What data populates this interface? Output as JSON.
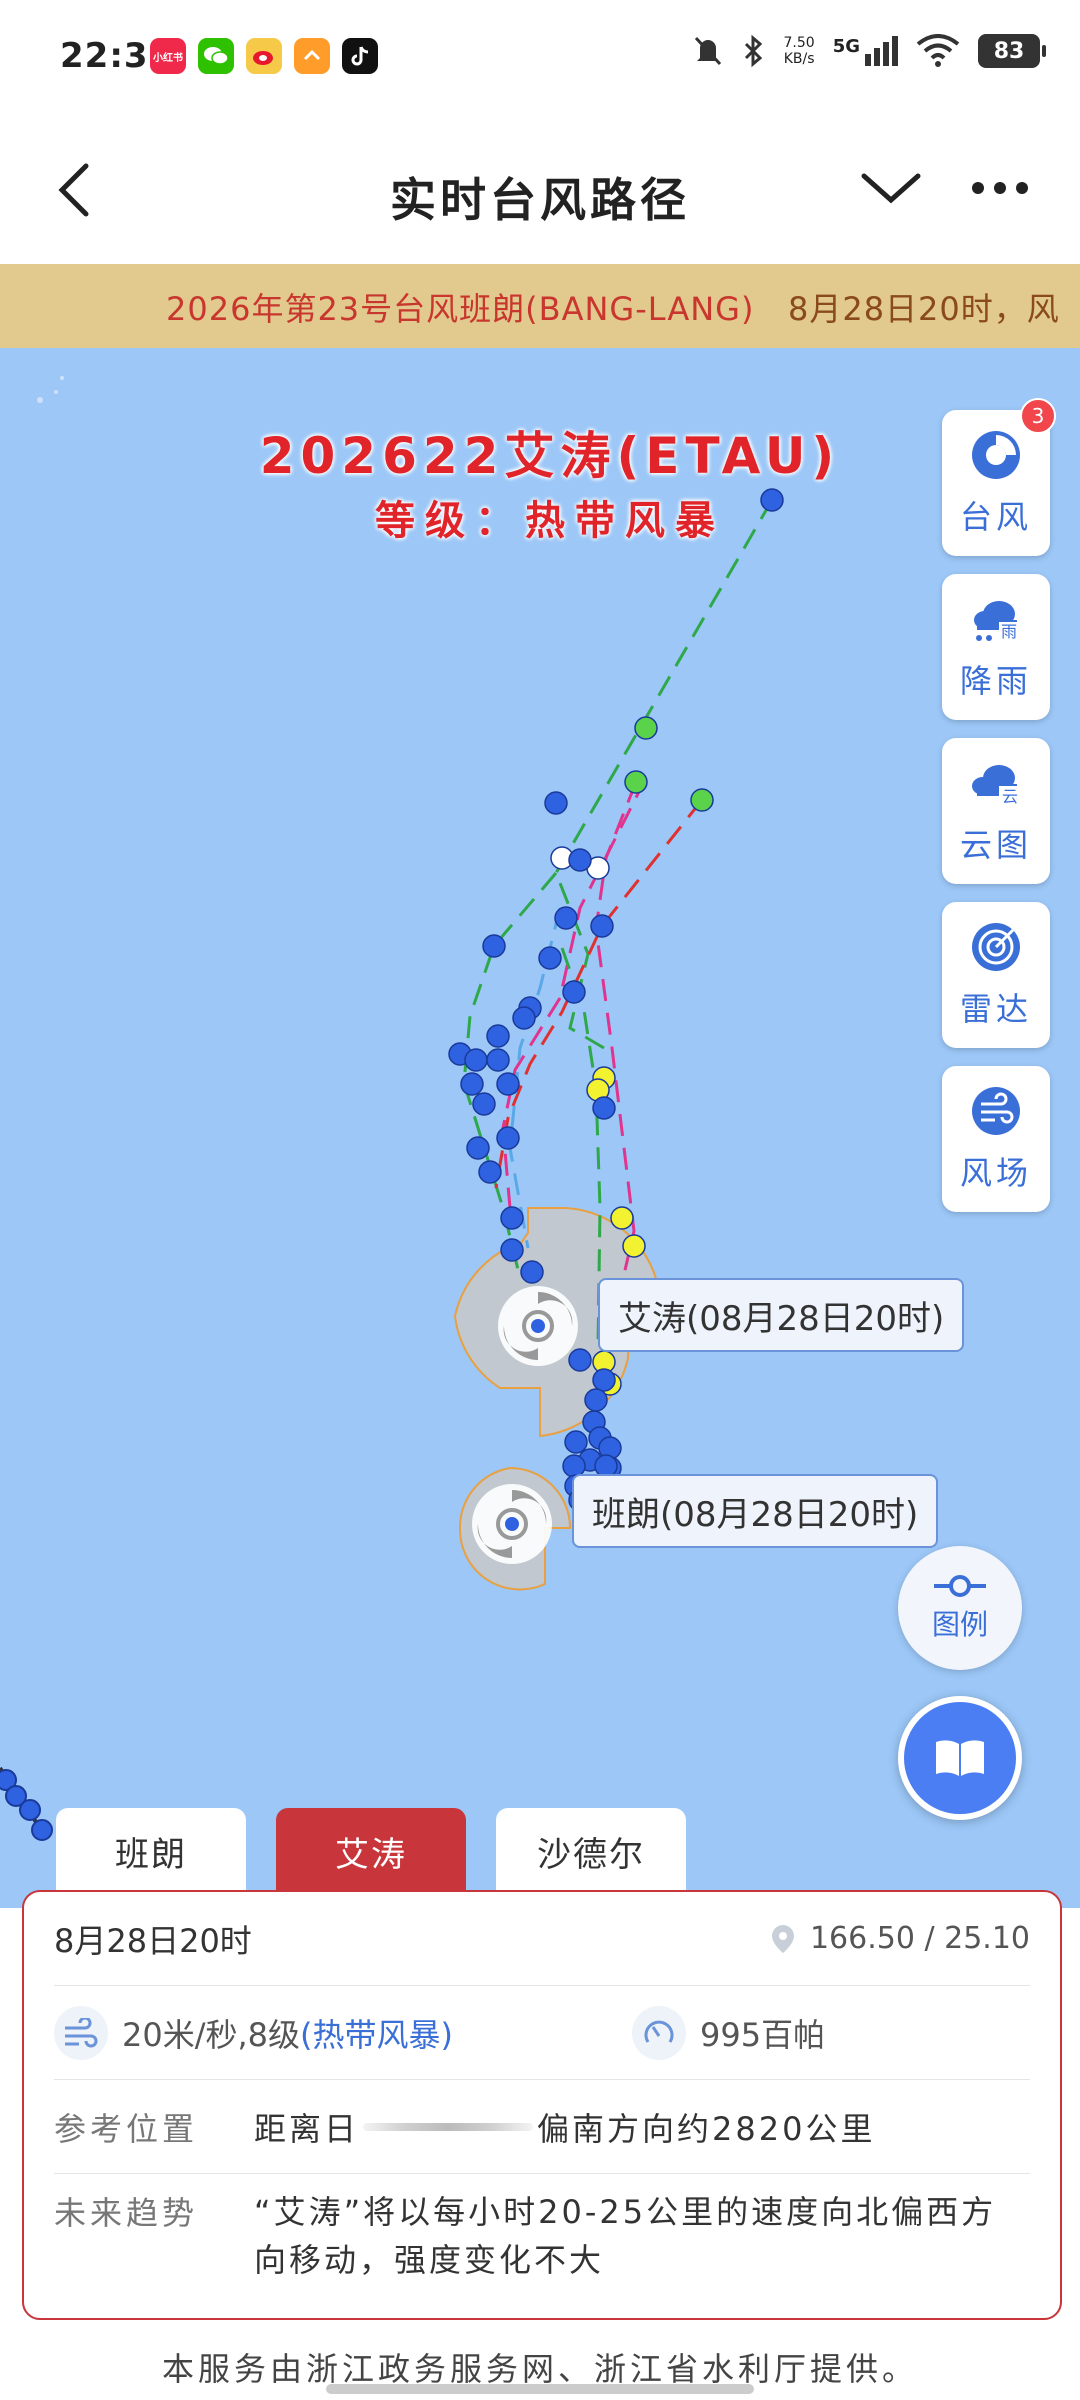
{
  "status_bar": {
    "time": "22:38",
    "app_icons": [
      {
        "name": "xiaohongshu-icon",
        "label": "小红书",
        "color": "#f0284a"
      },
      {
        "name": "wechat-icon",
        "label": "",
        "color": "#2dc100"
      },
      {
        "name": "weibo-icon",
        "label": "",
        "color": "#f7c948"
      },
      {
        "name": "orange-app-icon",
        "label": "",
        "color": "#ff9c2a"
      },
      {
        "name": "tiktok-icon",
        "label": "",
        "color": "#111111"
      }
    ],
    "net_speed_value": "7.50",
    "net_speed_unit": "KB/s",
    "network": "5G",
    "battery": "83"
  },
  "header": {
    "title": "实时台风路径"
  },
  "marquee": {
    "text_red": "2026年第23号台风班朗(BANG-LANG)",
    "text_dark": "8月28日20时，风",
    "colors": {
      "bg": "#e2c98e",
      "text": "#c8362e"
    }
  },
  "map": {
    "title": "202622艾涛(ETAU)",
    "level": "等级：热带风暴",
    "labels": {
      "etau": "艾涛(08月28日20时)",
      "banglang": "班朗(08月28日20时)"
    },
    "tools": [
      {
        "id": "typhoon",
        "label": "台风",
        "icon": "typhoon-icon",
        "badge": "3"
      },
      {
        "id": "rain",
        "label": "降雨",
        "icon": "rain-cloud-icon",
        "glyph": "雨"
      },
      {
        "id": "cloud",
        "label": "云图",
        "icon": "cloud-icon",
        "glyph": "云"
      },
      {
        "id": "radar",
        "label": "雷达",
        "icon": "radar-icon"
      },
      {
        "id": "wind",
        "label": "风场",
        "icon": "wind-field-icon"
      }
    ],
    "legend_label": "图例"
  },
  "tabs": [
    {
      "label": "班朗",
      "active": false
    },
    {
      "label": "艾涛",
      "active": true
    },
    {
      "label": "沙德尔",
      "active": false
    }
  ],
  "info": {
    "time": "8月28日20时",
    "coords": "166.50 / 25.10",
    "wind": "20米/秒,8级",
    "wind_level": "(热带风暴)",
    "pressure": "995百帕",
    "ref_label": "参考位置",
    "ref_prefix": "距离日",
    "ref_suffix": "偏南方向约2820公里",
    "trend_label": "未来趋势",
    "trend_text": "“艾涛”将以每小时20-25公里的速度向北偏西方向移动，强度变化不大"
  },
  "footer": {
    "text": "本服务由浙江政务服务网、浙江省水利厅提供。"
  }
}
